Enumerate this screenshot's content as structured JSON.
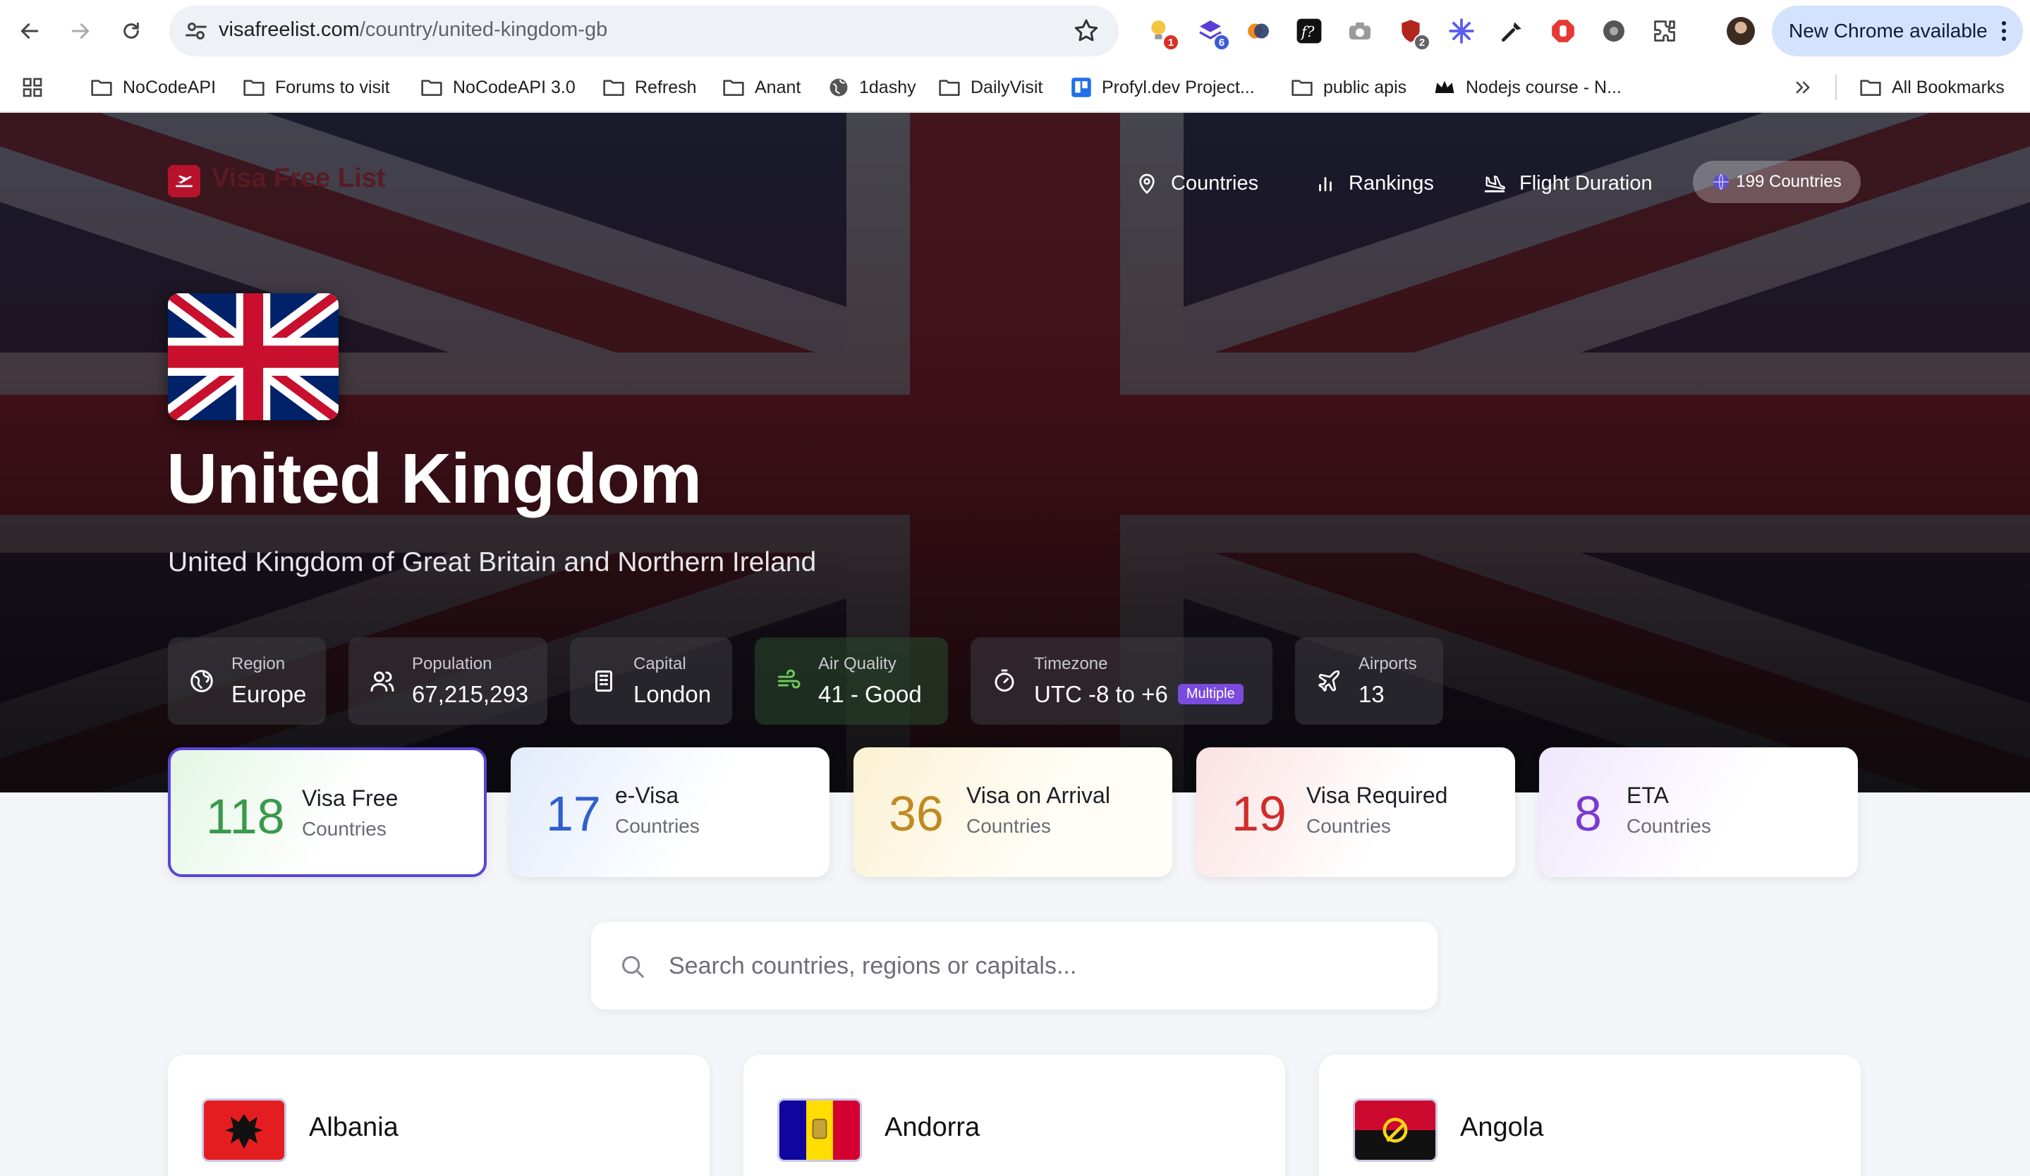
{
  "browser": {
    "url_host": "visafreelist.com",
    "url_path": "/country/united-kingdom-gb",
    "update_label": "New Chrome available",
    "extension_badges": [
      "1",
      "6",
      "2"
    ],
    "bookmarks": [
      "NoCodeAPI",
      "Forums to visit",
      "NoCodeAPI 3.0",
      "Refresh",
      "Anant",
      "1dashy",
      "DailyVisit",
      "Profyl.dev Project...",
      "public apis",
      "Nodejs course - N..."
    ],
    "all_bookmarks": "All Bookmarks"
  },
  "site": {
    "logo_text": "Visa Free List",
    "nav": [
      "Countries",
      "Rankings",
      "Flight Duration"
    ],
    "count_pill": "199 Countries"
  },
  "country": {
    "name": "United Kingdom",
    "official_name": "United Kingdom of Great Britain and Northern Ireland",
    "info": {
      "region_label": "Region",
      "region": "Europe",
      "population_label": "Population",
      "population": "67,215,293",
      "capital_label": "Capital",
      "capital": "London",
      "air_label": "Air Quality",
      "air": "41 - Good",
      "timezone_label": "Timezone",
      "timezone": "UTC -8 to +6",
      "timezone_badge": "Multiple",
      "airports_label": "Airports",
      "airports": "13"
    }
  },
  "stats": [
    {
      "value": "118",
      "title": "Visa Free",
      "sub": "Countries",
      "color": "#3a9a4a"
    },
    {
      "value": "17",
      "title": "e-Visa",
      "sub": "Countries",
      "color": "#2f5fd0"
    },
    {
      "value": "36",
      "title": "Visa on Arrival",
      "sub": "Countries",
      "color": "#c08a22"
    },
    {
      "value": "19",
      "title": "Visa Required",
      "sub": "Countries",
      "color": "#d12c2c"
    },
    {
      "value": "8",
      "title": "ETA",
      "sub": "Countries",
      "color": "#7a3ad0"
    }
  ],
  "search": {
    "placeholder": "Search countries, regions or capitals..."
  },
  "countries": [
    "Albania",
    "Andorra",
    "Angola"
  ]
}
